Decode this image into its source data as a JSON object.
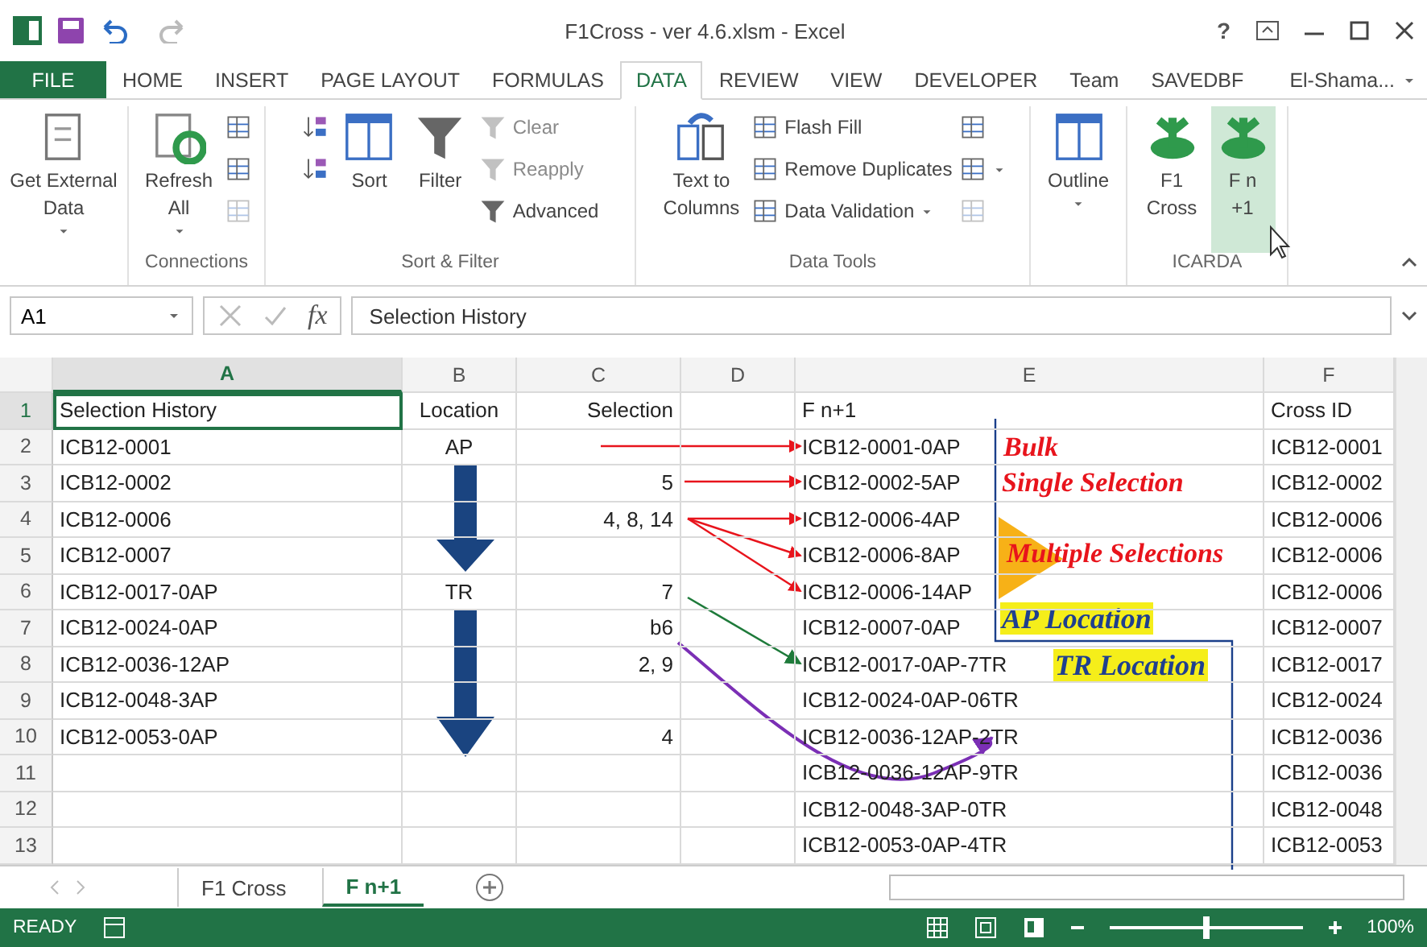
{
  "window": {
    "title": "F1Cross - ver 4.6.xlsm - Excel",
    "help": "?"
  },
  "tabs": [
    {
      "label": "FILE",
      "kind": "file",
      "selected": false
    },
    {
      "label": "HOME",
      "kind": "tab",
      "selected": false
    },
    {
      "label": "INSERT",
      "kind": "tab",
      "selected": false
    },
    {
      "label": "PAGE LAYOUT",
      "kind": "tab",
      "selected": false
    },
    {
      "label": "FORMULAS",
      "kind": "tab",
      "selected": false
    },
    {
      "label": "DATA",
      "kind": "tab",
      "selected": true
    },
    {
      "label": "REVIEW",
      "kind": "tab",
      "selected": false
    },
    {
      "label": "VIEW",
      "kind": "tab",
      "selected": false
    },
    {
      "label": "DEVELOPER",
      "kind": "tab",
      "selected": false
    },
    {
      "label": "Team",
      "kind": "tab",
      "selected": false
    },
    {
      "label": "SAVEDBF",
      "kind": "tab",
      "selected": false
    }
  ],
  "account": "El-Shama...",
  "ribbon": [
    {
      "items": [
        {
          "kind": "large",
          "lines": [
            "Get External",
            "Data"
          ],
          "dropdown": true,
          "hovered": false
        }
      ]
    },
    {
      "label": "Connections",
      "items": [
        {
          "kind": "large",
          "lines": [
            "Refresh",
            "All"
          ],
          "dropdown": true,
          "hovered": false
        },
        {
          "kind": "stack",
          "buttons": [
            {
              "disabled": false
            },
            {
              "disabled": false
            },
            {
              "disabled": true
            }
          ]
        }
      ]
    },
    {
      "label": "Sort & Filter",
      "items": [
        {
          "kind": "stack",
          "buttons": [
            {
              "disabled": false
            },
            {
              "disabled": false
            }
          ]
        },
        {
          "kind": "large",
          "lines": [
            "Sort"
          ],
          "dropdown": false,
          "hovered": false
        },
        {
          "kind": "large",
          "lines": [
            "Filter"
          ],
          "dropdown": false,
          "hovered": false
        },
        {
          "kind": "stack",
          "buttons": [
            {
              "label": "Clear",
              "disabled": true
            },
            {
              "label": "Reapply",
              "disabled": true
            },
            {
              "label": "Advanced",
              "disabled": false
            }
          ]
        }
      ]
    },
    {
      "label": "Data Tools",
      "items": [
        {
          "kind": "large",
          "lines": [
            "Text to",
            "Columns"
          ],
          "dropdown": false,
          "hovered": false
        },
        {
          "kind": "stack",
          "buttons": [
            {
              "label": "Flash Fill",
              "disabled": false
            },
            {
              "label": "Remove Duplicates",
              "disabled": false
            },
            {
              "label": "Data Validation",
              "disabled": false,
              "dropdown": true
            }
          ]
        },
        {
          "kind": "stack",
          "buttons": [
            {
              "disabled": false
            },
            {
              "disabled": false,
              "dropdown": true
            },
            {
              "disabled": true
            }
          ]
        }
      ]
    },
    {
      "items": [
        {
          "kind": "large",
          "lines": [
            "Outline"
          ],
          "dropdown": true,
          "hovered": false
        }
      ]
    },
    {
      "label": "ICARDA",
      "items": [
        {
          "kind": "large",
          "lines": [
            "F1",
            "Cross"
          ],
          "dropdown": false,
          "hovered": false
        },
        {
          "kind": "large",
          "lines": [
            "F n",
            "+1"
          ],
          "dropdown": false,
          "hovered": true
        }
      ]
    }
  ],
  "formula_bar": {
    "name_box": "A1",
    "function_label": "fx",
    "value": "Selection History"
  },
  "columns": [
    {
      "label": "A",
      "selected": true
    },
    {
      "label": "B",
      "selected": false
    },
    {
      "label": "C",
      "selected": false
    },
    {
      "label": "D",
      "selected": false
    },
    {
      "label": "E",
      "selected": false
    },
    {
      "label": "F",
      "selected": false
    }
  ],
  "rows": [
    {
      "number": "1",
      "selected": true,
      "cells": [
        "Selection History",
        "Location",
        "Selection",
        null,
        "F n+1",
        "Cross ID"
      ]
    },
    {
      "number": "2",
      "selected": false,
      "cells": [
        "ICB12-0001",
        "AP",
        null,
        null,
        "ICB12-0001-0AP",
        "ICB12-0001"
      ]
    },
    {
      "number": "3",
      "selected": false,
      "cells": [
        "ICB12-0002",
        null,
        "5",
        null,
        "ICB12-0002-5AP",
        "ICB12-0002"
      ]
    },
    {
      "number": "4",
      "selected": false,
      "cells": [
        "ICB12-0006",
        null,
        "4, 8, 14",
        null,
        "ICB12-0006-4AP",
        "ICB12-0006"
      ]
    },
    {
      "number": "5",
      "selected": false,
      "cells": [
        "ICB12-0007",
        null,
        null,
        null,
        "ICB12-0006-8AP",
        "ICB12-0006"
      ]
    },
    {
      "number": "6",
      "selected": false,
      "cells": [
        "ICB12-0017-0AP",
        "TR",
        "7",
        null,
        "ICB12-0006-14AP",
        "ICB12-0006"
      ]
    },
    {
      "number": "7",
      "selected": false,
      "cells": [
        "ICB12-0024-0AP",
        null,
        "b6",
        null,
        "ICB12-0007-0AP",
        "ICB12-0007"
      ]
    },
    {
      "number": "8",
      "selected": false,
      "cells": [
        "ICB12-0036-12AP",
        null,
        "2, 9",
        null,
        "ICB12-0017-0AP-7TR",
        "ICB12-0017"
      ]
    },
    {
      "number": "9",
      "selected": false,
      "cells": [
        "ICB12-0048-3AP",
        null,
        null,
        null,
        "ICB12-0024-0AP-06TR",
        "ICB12-0024"
      ]
    },
    {
      "number": "10",
      "selected": false,
      "cells": [
        "ICB12-0053-0AP",
        null,
        "4",
        null,
        "ICB12-0036-12AP-2TR",
        "ICB12-0036"
      ]
    },
    {
      "number": "11",
      "selected": false,
      "cells": [
        null,
        null,
        null,
        null,
        "ICB12-0036-12AP-9TR",
        "ICB12-0036"
      ]
    },
    {
      "number": "12",
      "selected": false,
      "cells": [
        null,
        null,
        null,
        null,
        "ICB12-0048-3AP-0TR",
        "ICB12-0048"
      ]
    },
    {
      "number": "13",
      "selected": false,
      "cells": [
        null,
        null,
        null,
        null,
        "ICB12-0053-0AP-4TR",
        "ICB12-0053"
      ]
    }
  ],
  "annotations": [
    {
      "text": "Bulk",
      "kind": "note"
    },
    {
      "text": "Single Selection",
      "kind": "note"
    },
    {
      "text": "Multiple Selections",
      "kind": "note"
    },
    {
      "text": "AP Location",
      "kind": "highlight"
    },
    {
      "text": "TR Location",
      "kind": "highlight"
    }
  ],
  "sheets": [
    {
      "label": "F1 Cross",
      "selected": false
    },
    {
      "label": "F n+1",
      "selected": true
    }
  ],
  "status_bar": {
    "mode": "READY",
    "zoom": "100%",
    "level": 0.5
  }
}
